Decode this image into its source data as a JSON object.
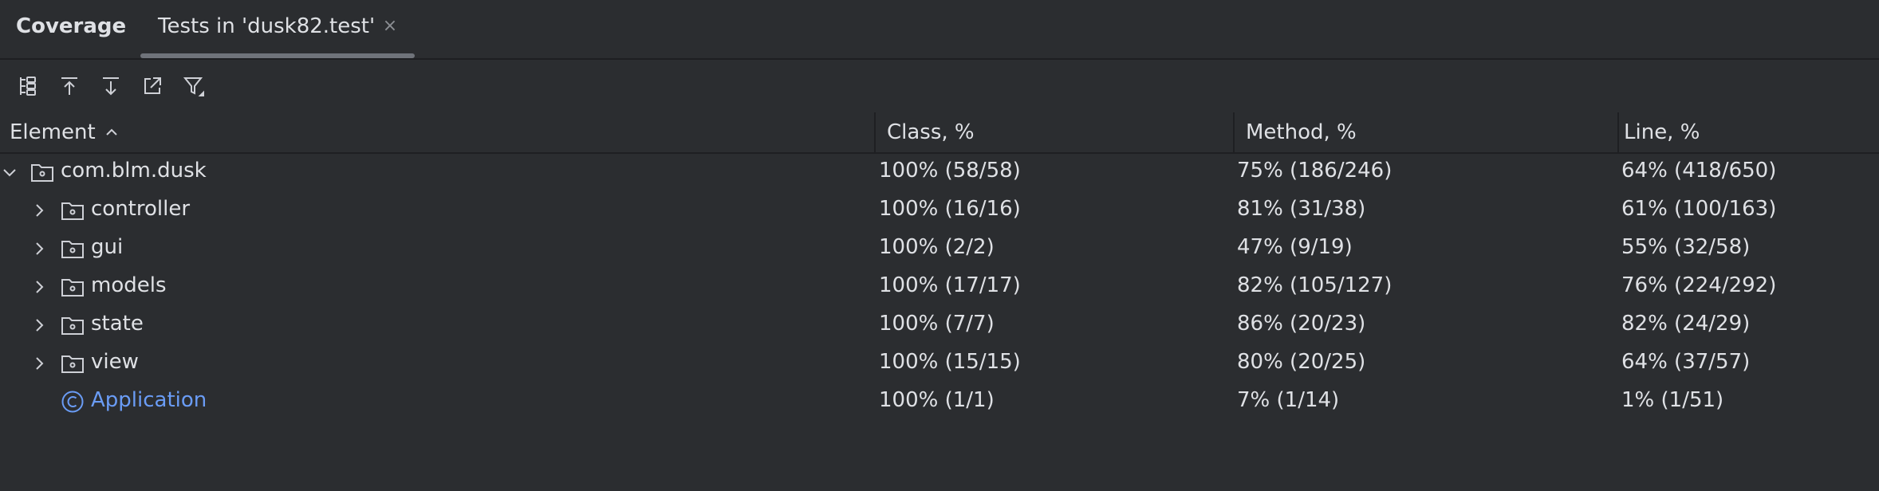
{
  "tabbar": {
    "title": "Coverage",
    "active_tab": "Tests in 'dusk82.test'",
    "close_glyph": "×"
  },
  "toolbar": {
    "buttons": [
      "flatten-packages-icon",
      "navigate-up-icon",
      "navigate-down-icon",
      "open-external-icon",
      "filter-icon"
    ]
  },
  "table": {
    "columns": [
      "Element",
      "Class, %",
      "Method, %",
      "Line, %"
    ],
    "sort": "ascending",
    "rows": [
      {
        "name": "com.blm.dusk",
        "class": "100% (58/58)",
        "method": "75% (186/246)",
        "line": "64% (418/650)",
        "type": "package",
        "expanded": true
      },
      {
        "name": "controller",
        "class": "100% (16/16)",
        "method": "81% (31/38)",
        "line": "61% (100/163)",
        "type": "package",
        "expanded": false
      },
      {
        "name": "gui",
        "class": "100% (2/2)",
        "method": "47% (9/19)",
        "line": "55% (32/58)",
        "type": "package",
        "expanded": false
      },
      {
        "name": "models",
        "class": "100% (17/17)",
        "method": "82% (105/127)",
        "line": "76% (224/292)",
        "type": "package",
        "expanded": false
      },
      {
        "name": "state",
        "class": "100% (7/7)",
        "method": "86% (20/23)",
        "line": "82% (24/29)",
        "type": "package",
        "expanded": false
      },
      {
        "name": "view",
        "class": "100% (15/15)",
        "method": "80% (20/25)",
        "line": "64% (37/57)",
        "type": "package",
        "expanded": false
      },
      {
        "name": "Application",
        "class": "100% (1/1)",
        "method": "7% (1/14)",
        "line": "1% (1/51)",
        "type": "class",
        "expanded": false
      }
    ]
  },
  "colors": {
    "background": "#2b2d30",
    "text": "#dfe1e5",
    "link": "#6a9cf5",
    "divider": "#1e1f22"
  }
}
